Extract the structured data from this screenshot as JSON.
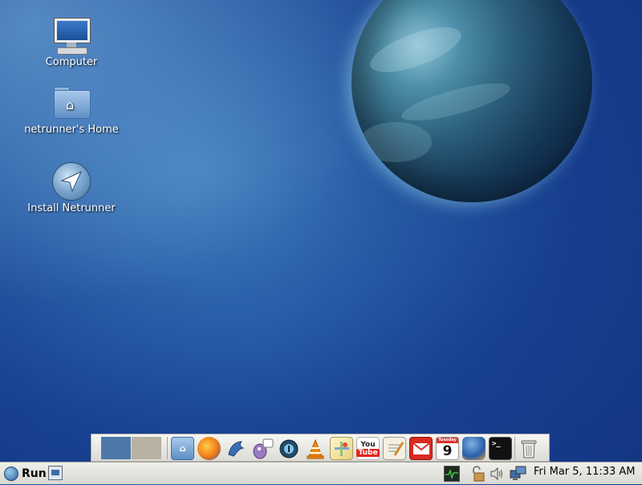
{
  "desktop": {
    "icons": [
      {
        "label": "Computer",
        "icon": "computer-icon"
      },
      {
        "label": "netrunner's Home",
        "icon": "home-folder-icon"
      },
      {
        "label": "Install Netrunner",
        "icon": "install-netrunner-icon"
      }
    ]
  },
  "dock": {
    "workspaces": [
      "workspace-1",
      "workspace-2"
    ],
    "launchers": [
      {
        "name": "home-folder-launcher",
        "icon": "folder-home-icon"
      },
      {
        "name": "firefox-launcher",
        "icon": "firefox-icon"
      },
      {
        "name": "thunderbird-bird-launcher",
        "icon": "bird-icon"
      },
      {
        "name": "pidgin-launcher",
        "icon": "pidgin-icon"
      },
      {
        "name": "player-launcher",
        "icon": "player-icon"
      },
      {
        "name": "vlc-launcher",
        "icon": "vlc-cone-icon"
      },
      {
        "name": "maps-launcher",
        "icon": "maps-icon"
      },
      {
        "name": "youtube-launcher",
        "icon": "youtube-icon",
        "text_top": "You",
        "text_bottom": "Tube"
      },
      {
        "name": "notes-launcher",
        "icon": "notepad-icon"
      },
      {
        "name": "gmail-launcher",
        "icon": "gmail-icon"
      },
      {
        "name": "calendar-launcher",
        "icon": "calendar-icon",
        "day_label": "Tuesday",
        "day_number": "9"
      },
      {
        "name": "thunderbird-launcher",
        "icon": "thunderbird-icon"
      },
      {
        "name": "terminal-launcher",
        "icon": "terminal-icon",
        "text": ">_"
      },
      {
        "name": "trash-launcher",
        "icon": "trash-icon"
      }
    ]
  },
  "panel": {
    "run_label": "Run",
    "clock": "Fri Mar  5, 11:33 AM"
  }
}
